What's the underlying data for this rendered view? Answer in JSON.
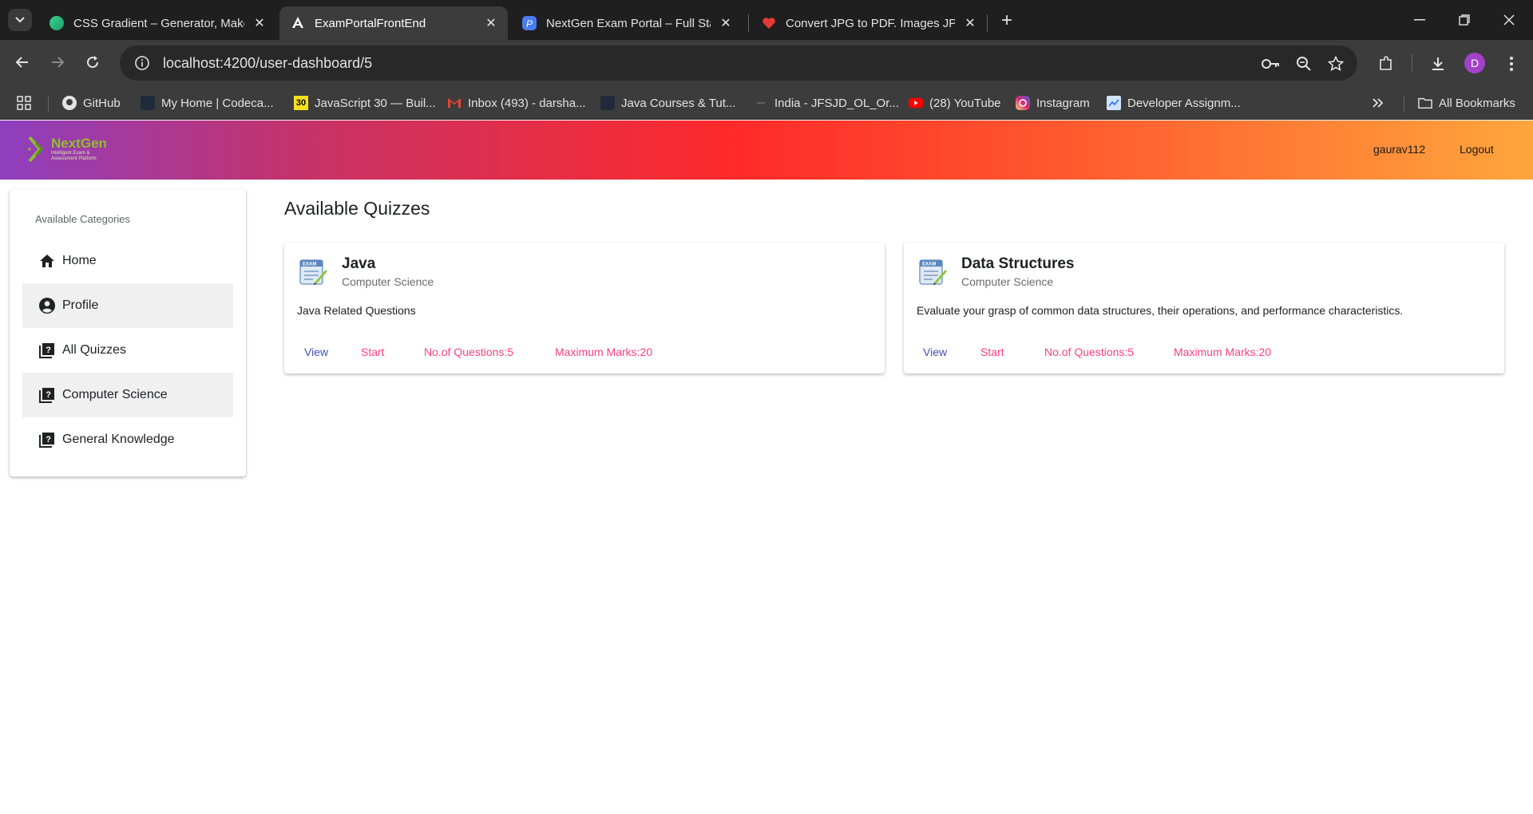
{
  "browser": {
    "tabs": [
      {
        "title": "CSS Gradient – Generator, Make",
        "active": false
      },
      {
        "title": "ExamPortalFrontEnd",
        "active": true
      },
      {
        "title": "NextGen Exam Portal – Full Stac",
        "active": false
      },
      {
        "title": "Convert JPG to PDF. Images JPG",
        "active": false
      }
    ],
    "url": "localhost:4200/user-dashboard/5",
    "profile_initial": "D",
    "bookmarks": [
      {
        "label": "GitHub"
      },
      {
        "label": "My Home | Codeca..."
      },
      {
        "label": "JavaScript 30 — Buil..."
      },
      {
        "label": "Inbox (493) - darsha..."
      },
      {
        "label": "Java Courses & Tut..."
      },
      {
        "label": "India - JFSJD_OL_Or..."
      },
      {
        "label": "(28) YouTube"
      },
      {
        "label": "Instagram"
      },
      {
        "label": "Developer Assignm..."
      }
    ],
    "all_bookmarks": "All Bookmarks"
  },
  "app": {
    "logo": {
      "title": "NextGen",
      "subtitle": "Intelligent Exam & Assessment Platform"
    },
    "nav": {
      "username": "gaurav112",
      "logout": "Logout"
    },
    "sidebar": {
      "header": "Available Categories",
      "items": [
        {
          "label": "Home",
          "icon": "home-icon"
        },
        {
          "label": "Profile",
          "icon": "account-circle-icon"
        },
        {
          "label": "All Quizzes",
          "icon": "quiz-icon"
        },
        {
          "label": "Computer Science",
          "icon": "quiz-icon"
        },
        {
          "label": "General Knowledge",
          "icon": "quiz-icon"
        }
      ]
    },
    "page_title": "Available Quizzes",
    "quizzes": [
      {
        "title": "Java",
        "category": "Computer Science",
        "description": "Java Related Questions",
        "view": "View",
        "start": "Start",
        "questions": "No.of Questions:5",
        "marks": "Maximum Marks:20"
      },
      {
        "title": "Data Structures",
        "category": "Computer Science",
        "description": "Evaluate your grasp of common data structures, their operations, and performance characteristics.",
        "view": "View",
        "start": "Start",
        "questions": "No.of Questions:5",
        "marks": "Maximum Marks:20"
      }
    ]
  },
  "colors": {
    "primary": "#3f51b5",
    "accent": "#ff4081",
    "nav_gradient": [
      "#8e3fbf",
      "#ff2a2a",
      "#ffa63d"
    ]
  }
}
